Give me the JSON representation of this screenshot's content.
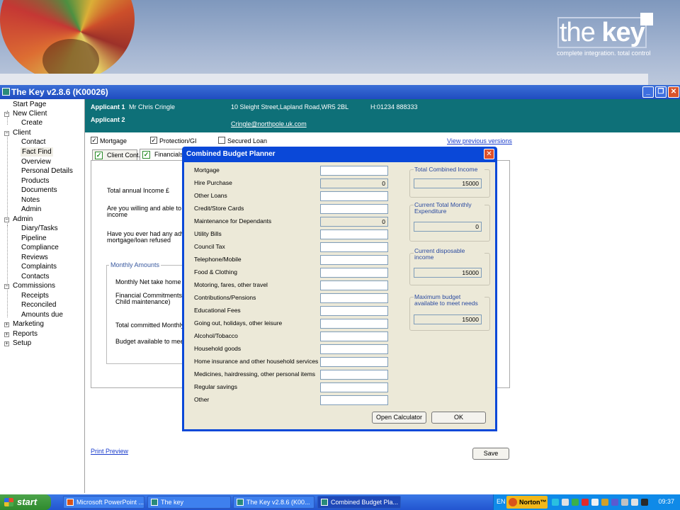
{
  "banner": {
    "logo_the": "the ",
    "logo_key": "key",
    "tagline": "complete integration. total control"
  },
  "window": {
    "title": "The Key v2.8.6 (K00026)"
  },
  "sidebar": {
    "items": [
      {
        "label": "Start Page"
      },
      {
        "label": "New Client"
      },
      {
        "label": "Create"
      },
      {
        "label": "Client"
      },
      {
        "label": "Contact"
      },
      {
        "label": "Fact Find"
      },
      {
        "label": "Overview"
      },
      {
        "label": "Personal Details"
      },
      {
        "label": "Products"
      },
      {
        "label": "Documents"
      },
      {
        "label": "Notes"
      },
      {
        "label": "Admin"
      },
      {
        "label": "Admin"
      },
      {
        "label": "Diary/Tasks"
      },
      {
        "label": "Pipeline"
      },
      {
        "label": "Compliance"
      },
      {
        "label": "Reviews"
      },
      {
        "label": "Complaints"
      },
      {
        "label": "Contacts"
      },
      {
        "label": "Commissions"
      },
      {
        "label": "Receipts"
      },
      {
        "label": "Reconciled"
      },
      {
        "label": "Amounts due"
      },
      {
        "label": "Marketing"
      },
      {
        "label": "Reports"
      },
      {
        "label": "Setup"
      }
    ]
  },
  "applicant": {
    "a1_label": "Applicant 1",
    "a1_name": "Mr Chris Cringle",
    "a1_address": "10 Sleight Street,Lapland Road,WR5 2BL",
    "a1_phone": "H:01234 888333",
    "a2_label": "Applicant 2",
    "email": "Cringle@northpole.uk.com"
  },
  "main": {
    "checks": [
      {
        "label": "Mortgage",
        "checked": true
      },
      {
        "label": "Protection/GI",
        "checked": true
      },
      {
        "label": "Secured Loan",
        "checked": false
      }
    ],
    "view_previous": "View previous versions",
    "tabs": [
      {
        "label": "Client Cont."
      },
      {
        "label": "Financials"
      }
    ],
    "total_income_label": "Total annual Income £",
    "willing_label": "Are you willing and able to pr",
    "willing_label2": "income",
    "adverse_label": "Have you ever had any adver",
    "adverse_label2": "mortgage/loan refused",
    "monthly_title": "Monthly Amounts",
    "monthly_net": "Monthly Net take home pa",
    "fin_commit": "Financial Commitments (I",
    "fin_commit2": "Child maintenance)",
    "total_committed": "Total committed Monthly L",
    "budget_meet": "Budget available to meet N",
    "print_preview": "Print Preview",
    "save": "Save"
  },
  "dialog": {
    "title": "Combined Budget Planner",
    "rows": [
      {
        "label": "Mortgage",
        "value": "",
        "readonly": false
      },
      {
        "label": "Hire Purchase",
        "value": "0",
        "readonly": true
      },
      {
        "label": "Other Loans",
        "value": "",
        "readonly": false
      },
      {
        "label": "Credit/Store Cards",
        "value": "",
        "readonly": false
      },
      {
        "label": "Maintenance for Dependants",
        "value": "0",
        "readonly": true
      },
      {
        "label": "Utility Bills",
        "value": "",
        "readonly": false
      },
      {
        "label": "Council Tax",
        "value": "",
        "readonly": false
      },
      {
        "label": "Telephone/Mobile",
        "value": "",
        "readonly": false
      },
      {
        "label": "Food & Clothing",
        "value": "",
        "readonly": false
      },
      {
        "label": "Motoring, fares, other travel",
        "value": "",
        "readonly": false
      },
      {
        "label": "Contributions/Pensions",
        "value": "",
        "readonly": false
      },
      {
        "label": "Educational Fees",
        "value": "",
        "readonly": false
      },
      {
        "label": "Going out, holidays, other leisure",
        "value": "",
        "readonly": false
      },
      {
        "label": "Alcohol/Tobacco",
        "value": "",
        "readonly": false
      },
      {
        "label": "Household goods",
        "value": "",
        "readonly": false
      },
      {
        "label": "Home insurance and other household services",
        "value": "",
        "readonly": false
      },
      {
        "label": "Medicines, hairdressing, other personal items",
        "value": "",
        "readonly": false
      },
      {
        "label": "Regular savings",
        "value": "",
        "readonly": false
      },
      {
        "label": "Other",
        "value": "",
        "readonly": false
      }
    ],
    "summary": [
      {
        "title": "Total Combined Income",
        "value": "15000"
      },
      {
        "title": "Current Total Monthly Expenditure",
        "value": "0"
      },
      {
        "title": "Current disposable income",
        "value": "15000"
      },
      {
        "title": "Maximum budget available to meet needs",
        "value": "15000"
      }
    ],
    "open_calculator": "Open Calculator",
    "ok": "OK"
  },
  "taskbar": {
    "start": "start",
    "tasks": [
      {
        "label": "Microsoft PowerPoint ...",
        "active": false
      },
      {
        "label": "The key",
        "active": false
      },
      {
        "label": "The Key v2.8.6 (K00...",
        "active": false
      },
      {
        "label": "Combined Budget Pla...",
        "active": true
      }
    ],
    "lang": "EN",
    "norton": "Norton™",
    "clock": "09:37"
  },
  "colors": {
    "header_teal": "#0e7078",
    "titlebar_blue": "#1f4cc0",
    "dialog_bg": "#ece9d8",
    "link_blue": "#1a3ccc"
  }
}
